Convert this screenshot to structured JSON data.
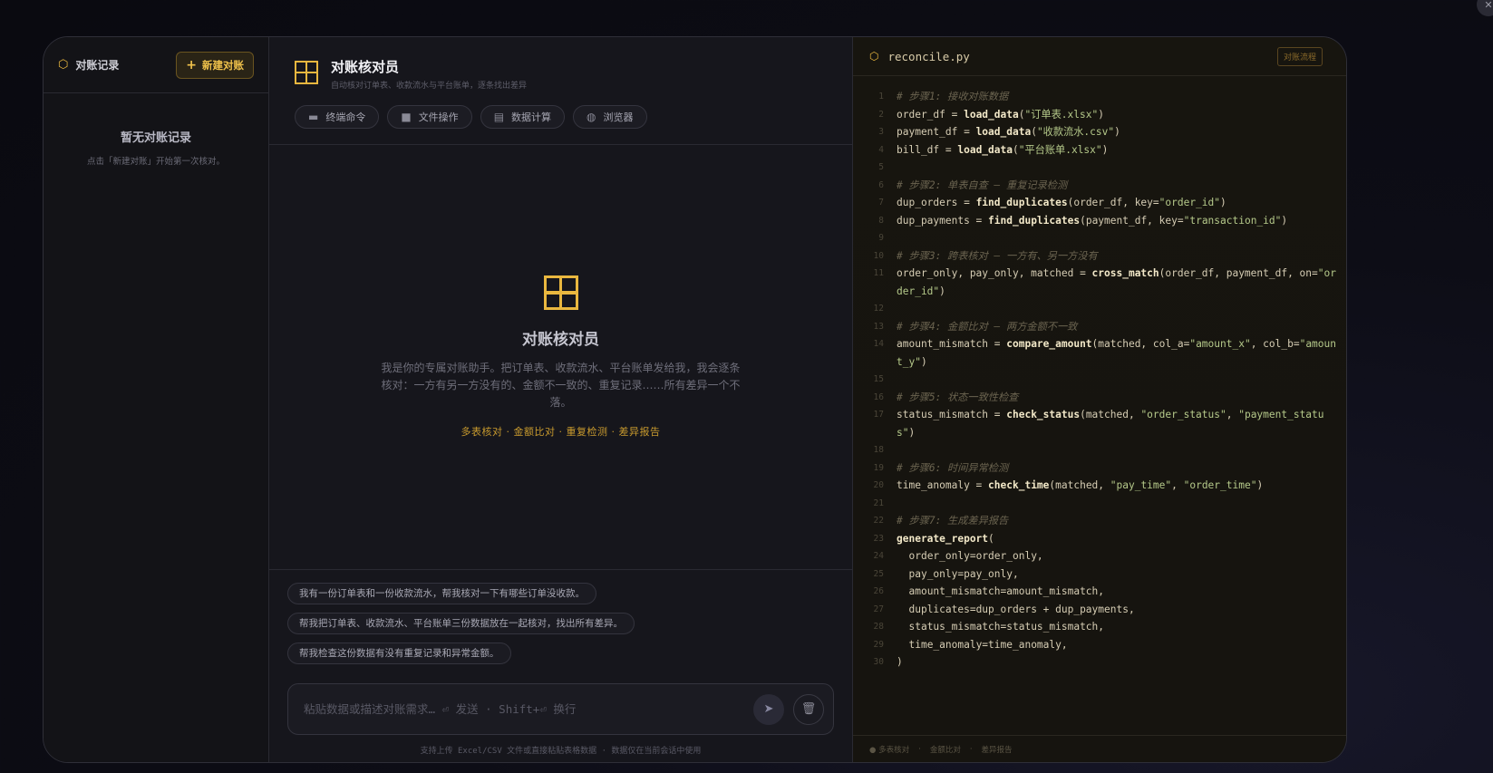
{
  "sidebar": {
    "title": "对账记录",
    "new_button": "新建对账",
    "empty_title": "暂无对账记录",
    "empty_hint": "点击「新建对账」开始第一次核对。"
  },
  "header": {
    "title": "对账核对员",
    "subtitle": "自动核对订单表、收款流水与平台账单，逐条找出差异",
    "tools": [
      {
        "label": "终端命令",
        "icon": "terminal-icon"
      },
      {
        "label": "文件操作",
        "icon": "folder-icon"
      },
      {
        "label": "数据计算",
        "icon": "calculator-icon"
      },
      {
        "label": "浏览器",
        "icon": "globe-icon"
      }
    ]
  },
  "hero": {
    "title": "对账核对员",
    "description": "我是你的专属对账助手。把订单表、收款流水、平台账单发给我，我会逐条核对：一方有另一方没有的、金额不一致的、重复记录……所有差异一个不落。",
    "tags": "多表核对 · 金额比对 · 重复检测 · 差异报告"
  },
  "suggestions": [
    "我有一份订单表和一份收款流水，帮我核对一下有哪些订单没收款。",
    "帮我把订单表、收款流水、平台账单三份数据放在一起核对，找出所有差异。",
    "帮我检查这份数据有没有重复记录和异常金额。"
  ],
  "input": {
    "placeholder": "粘贴数据或描述对账需求… ⏎ 发送 · Shift+⏎ 换行",
    "hint": "支持上传 Excel/CSV 文件或直接粘贴表格数据 · 数据仅在当前会话中使用"
  },
  "code": {
    "filename": "reconcile.py",
    "badge": "对账流程",
    "footer": [
      "● 多表核对",
      "金额比对",
      "差异报告"
    ]
  },
  "colors": {
    "accent": "#e9b73f",
    "background": "#0d0d16",
    "panel": "#16161c"
  }
}
